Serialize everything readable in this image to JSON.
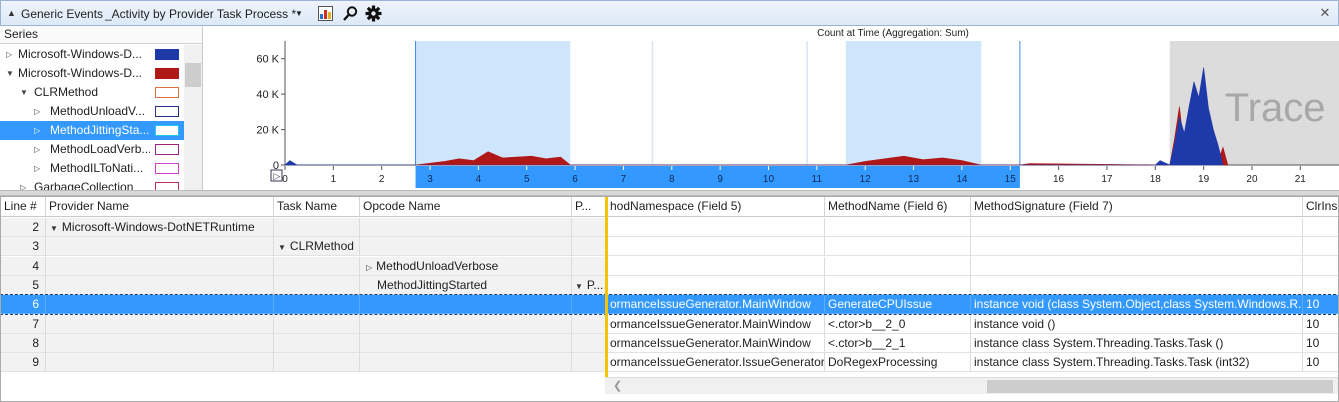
{
  "panel": {
    "group_label": "Generic Events",
    "view_title": "_Activity by Provider Task Process *",
    "icons": [
      "chart-icon",
      "search-icon",
      "gear-icon",
      "close-icon"
    ]
  },
  "series": {
    "header": "Series",
    "items": [
      {
        "label": "Microsoft-Windows-D...",
        "expander": "collapsed",
        "indent": 0,
        "swatch": "#1e3aa8",
        "filled": true,
        "selected": false
      },
      {
        "label": "Microsoft-Windows-D...",
        "expander": "expanded",
        "indent": 0,
        "swatch": "#b01818",
        "filled": true,
        "selected": false
      },
      {
        "label": "CLRMethod",
        "expander": "expanded",
        "indent": 1,
        "swatch": "#e07040",
        "filled": false,
        "selected": false
      },
      {
        "label": "MethodUnloadV...",
        "expander": "collapsed",
        "indent": 2,
        "swatch": "#2a2a8a",
        "filled": false,
        "selected": false
      },
      {
        "label": "MethodJittingSta...",
        "expander": "collapsed",
        "indent": 2,
        "swatch": "#1ec8e8",
        "filled": false,
        "selected": true
      },
      {
        "label": "MethodLoadVerb...",
        "expander": "collapsed",
        "indent": 2,
        "swatch": "#a0208a",
        "filled": false,
        "selected": false
      },
      {
        "label": "MethodILToNati...",
        "expander": "collapsed",
        "indent": 2,
        "swatch": "#d040d0",
        "filled": false,
        "selected": false
      },
      {
        "label": "GarbageCollection",
        "expander": "collapsed",
        "indent": 1,
        "swatch": "#c03060",
        "filled": false,
        "selected": false
      }
    ]
  },
  "chart_data": {
    "type": "area",
    "title": "Count at Time (Aggregation: Sum)",
    "ylim": [
      0,
      70000
    ],
    "yticks": [
      {
        "v": 0,
        "label": "0"
      },
      {
        "v": 20000,
        "label": "20 K"
      },
      {
        "v": 40000,
        "label": "40 K"
      },
      {
        "v": 60000,
        "label": "60 K"
      }
    ],
    "xlim": [
      0,
      21.8
    ],
    "xticks": [
      "0",
      "1",
      "2",
      "3",
      "4",
      "5",
      "6",
      "7",
      "8",
      "9",
      "10",
      "11",
      "12",
      "13",
      "14",
      "15",
      "16",
      "17",
      "18",
      "19",
      "20",
      "21"
    ],
    "selection_range": [
      2.7,
      15.2
    ],
    "highlight_ranges": [
      [
        2.7,
        5.9
      ],
      [
        11.6,
        14.4
      ]
    ],
    "trace_overlay": {
      "range": [
        18.3,
        21.8
      ],
      "label": "Trace"
    },
    "markers": [
      2.7,
      15.2,
      7.6,
      10.8
    ],
    "series": [
      {
        "name": "Microsoft-Windows-D...",
        "color": "#b01818",
        "x": [
          2.7,
          3.0,
          3.3,
          3.6,
          3.9,
          4.2,
          4.5,
          4.8,
          5.1,
          5.4,
          5.7,
          5.9,
          11.6,
          12.0,
          12.4,
          12.8,
          13.2,
          13.6,
          14.0,
          14.4,
          15.2,
          15.4,
          18.3,
          18.4,
          18.5,
          18.6,
          18.7,
          18.8,
          18.9,
          19.0,
          19.1,
          19.2,
          19.3,
          19.4,
          19.5
        ],
        "y": [
          0,
          1000,
          2000,
          3500,
          2500,
          7500,
          4000,
          4500,
          5000,
          3500,
          4500,
          0,
          0,
          2000,
          3500,
          5000,
          3000,
          4000,
          2500,
          0,
          0,
          800,
          0,
          15000,
          33000,
          8000,
          25000,
          43000,
          12000,
          27000,
          18000,
          9000,
          2000,
          10000,
          0
        ]
      },
      {
        "name": "Microsoft-Windows-D...",
        "color": "#1e3aa8",
        "x": [
          0,
          0.1,
          0.25,
          18.0,
          18.1,
          18.3,
          18.4,
          18.5,
          18.6,
          18.7,
          18.8,
          18.9,
          19.0,
          19.1,
          19.2,
          19.3,
          19.4
        ],
        "y": [
          0,
          2500,
          0,
          0,
          2500,
          0,
          12000,
          27000,
          18000,
          33000,
          47000,
          38000,
          55000,
          32000,
          20000,
          11000,
          0
        ]
      }
    ]
  },
  "table": {
    "columns": [
      "Line #",
      "Provider Name",
      "Task Name",
      "Opcode Name",
      "P...",
      "hodNamespace (Field 5)",
      "MethodName (Field 6)",
      "MethodSignature (Field 7)",
      "ClrIns"
    ],
    "rows": [
      {
        "line": "2",
        "provider": "Microsoft-Windows-DotNETRuntime",
        "task": "",
        "opcode": "",
        "p": "",
        "ns": "",
        "method": "",
        "sig": "",
        "clr": "",
        "selected": false
      },
      {
        "line": "3",
        "provider": "",
        "task": "CLRMethod",
        "opcode": "",
        "p": "",
        "ns": "",
        "method": "",
        "sig": "",
        "clr": "",
        "selected": false
      },
      {
        "line": "4",
        "provider": "",
        "task": "",
        "opcode": "MethodUnloadVerbose",
        "p": "",
        "ns": "",
        "method": "",
        "sig": "",
        "clr": "",
        "selected": false
      },
      {
        "line": "5",
        "provider": "",
        "task": "",
        "opcode": "MethodJittingStarted",
        "p": "P...",
        "ns": "",
        "method": "",
        "sig": "",
        "clr": "",
        "selected": false
      },
      {
        "line": "6",
        "provider": "",
        "task": "",
        "opcode": "",
        "p": "",
        "ns": "ormanceIssueGenerator.MainWindow",
        "method": "GenerateCPUIssue",
        "sig": "instance void  (class System.Object,class System.Windows.R...",
        "clr": "10",
        "selected": true
      },
      {
        "line": "7",
        "provider": "",
        "task": "",
        "opcode": "",
        "p": "",
        "ns": "ormanceIssueGenerator.MainWindow",
        "method": "<.ctor>b__2_0",
        "sig": "instance void  ()",
        "clr": "10",
        "selected": false
      },
      {
        "line": "8",
        "provider": "",
        "task": "",
        "opcode": "",
        "p": "",
        "ns": "ormanceIssueGenerator.MainWindow",
        "method": "<.ctor>b__2_1",
        "sig": "instance class System.Threading.Tasks.Task  ()",
        "clr": "10",
        "selected": false
      },
      {
        "line": "9",
        "provider": "",
        "task": "",
        "opcode": "",
        "p": "",
        "ns": "ormanceIssueGenerator.IssueGenerator",
        "method": "DoRegexProcessing",
        "sig": "instance class System.Threading.Tasks.Task  (int32)",
        "clr": "10",
        "selected": false
      }
    ]
  }
}
